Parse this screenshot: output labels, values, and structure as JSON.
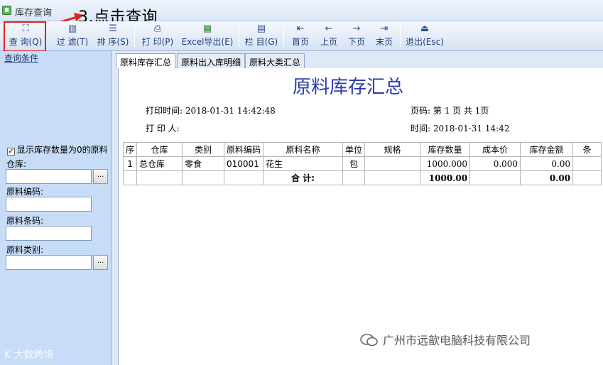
{
  "window": {
    "title": "库存查询"
  },
  "annotation": {
    "text": "3.点击查询"
  },
  "toolbar": {
    "buttons": [
      {
        "id": "query",
        "icon": "binoculars-icon",
        "glyph": "⛶",
        "label": "查 询(Q)"
      },
      {
        "id": "filter",
        "icon": "filter-icon",
        "glyph": "▥",
        "label": "过 滤(T)"
      },
      {
        "id": "sort",
        "icon": "sort-icon",
        "glyph": "☰",
        "label": "排 序(S)"
      },
      {
        "id": "print",
        "icon": "printer-icon",
        "glyph": "⎙",
        "label": "打 印(P)"
      },
      {
        "id": "excel",
        "icon": "excel-icon",
        "glyph": "▦",
        "label": "Excel导出(E)"
      },
      {
        "id": "columns",
        "icon": "columns-icon",
        "glyph": "▤",
        "label": "栏 目(G)"
      },
      {
        "id": "first",
        "icon": "first-page-icon",
        "glyph": "⇤",
        "label": "首页"
      },
      {
        "id": "prev",
        "icon": "arrow-left-icon",
        "glyph": "←",
        "label": "上页"
      },
      {
        "id": "next",
        "icon": "arrow-right-icon",
        "glyph": "→",
        "label": "下页"
      },
      {
        "id": "last",
        "icon": "last-page-icon",
        "glyph": "⇥",
        "label": "末页"
      },
      {
        "id": "exit",
        "icon": "exit-icon",
        "glyph": "⏏",
        "label": "退出(Esc)"
      }
    ]
  },
  "left_panel": {
    "header": "查询条件",
    "show_zero_stock": {
      "checked": true,
      "label": "显示库存数量为0的原料"
    },
    "warehouse": {
      "label": "仓库:",
      "value": "",
      "button": "..."
    },
    "material_code": {
      "label": "原料编码:",
      "value": ""
    },
    "material_barcode": {
      "label": "原料条码:",
      "value": ""
    },
    "material_category": {
      "label": "原料类别:",
      "value": "",
      "button": "..."
    }
  },
  "tabs": [
    {
      "label": "原料库存汇总",
      "active": true
    },
    {
      "label": "原料出入库明细",
      "active": false
    },
    {
      "label": "原料大类汇总",
      "active": false
    }
  ],
  "report": {
    "title": "原料库存汇总",
    "print_time_label": "打印时间:",
    "print_time": "2018-01-31 14:42:48",
    "printer_label": "打 印 人:",
    "printer": "",
    "page_label": "页码:",
    "page_info": "第 1 页 共 1页",
    "time_label": "时间:",
    "time": "2018-01-31 14:42",
    "columns": [
      "序",
      "仓库",
      "类别",
      "原料编码",
      "原料名称",
      "单位",
      "规格",
      "库存数量",
      "成本价",
      "库存金额",
      "条"
    ],
    "rows": [
      [
        "1",
        "总仓库",
        "零食",
        "010001",
        "花生",
        "包",
        "",
        "1000.000",
        "0.000",
        "0.00",
        ""
      ]
    ],
    "total": {
      "label": "合 计:",
      "quantity": "1000.00",
      "amount": "0.00"
    }
  },
  "watermarks": {
    "left": "K 大数跨境",
    "right": "广州市远歆电脑科技有限公司"
  }
}
